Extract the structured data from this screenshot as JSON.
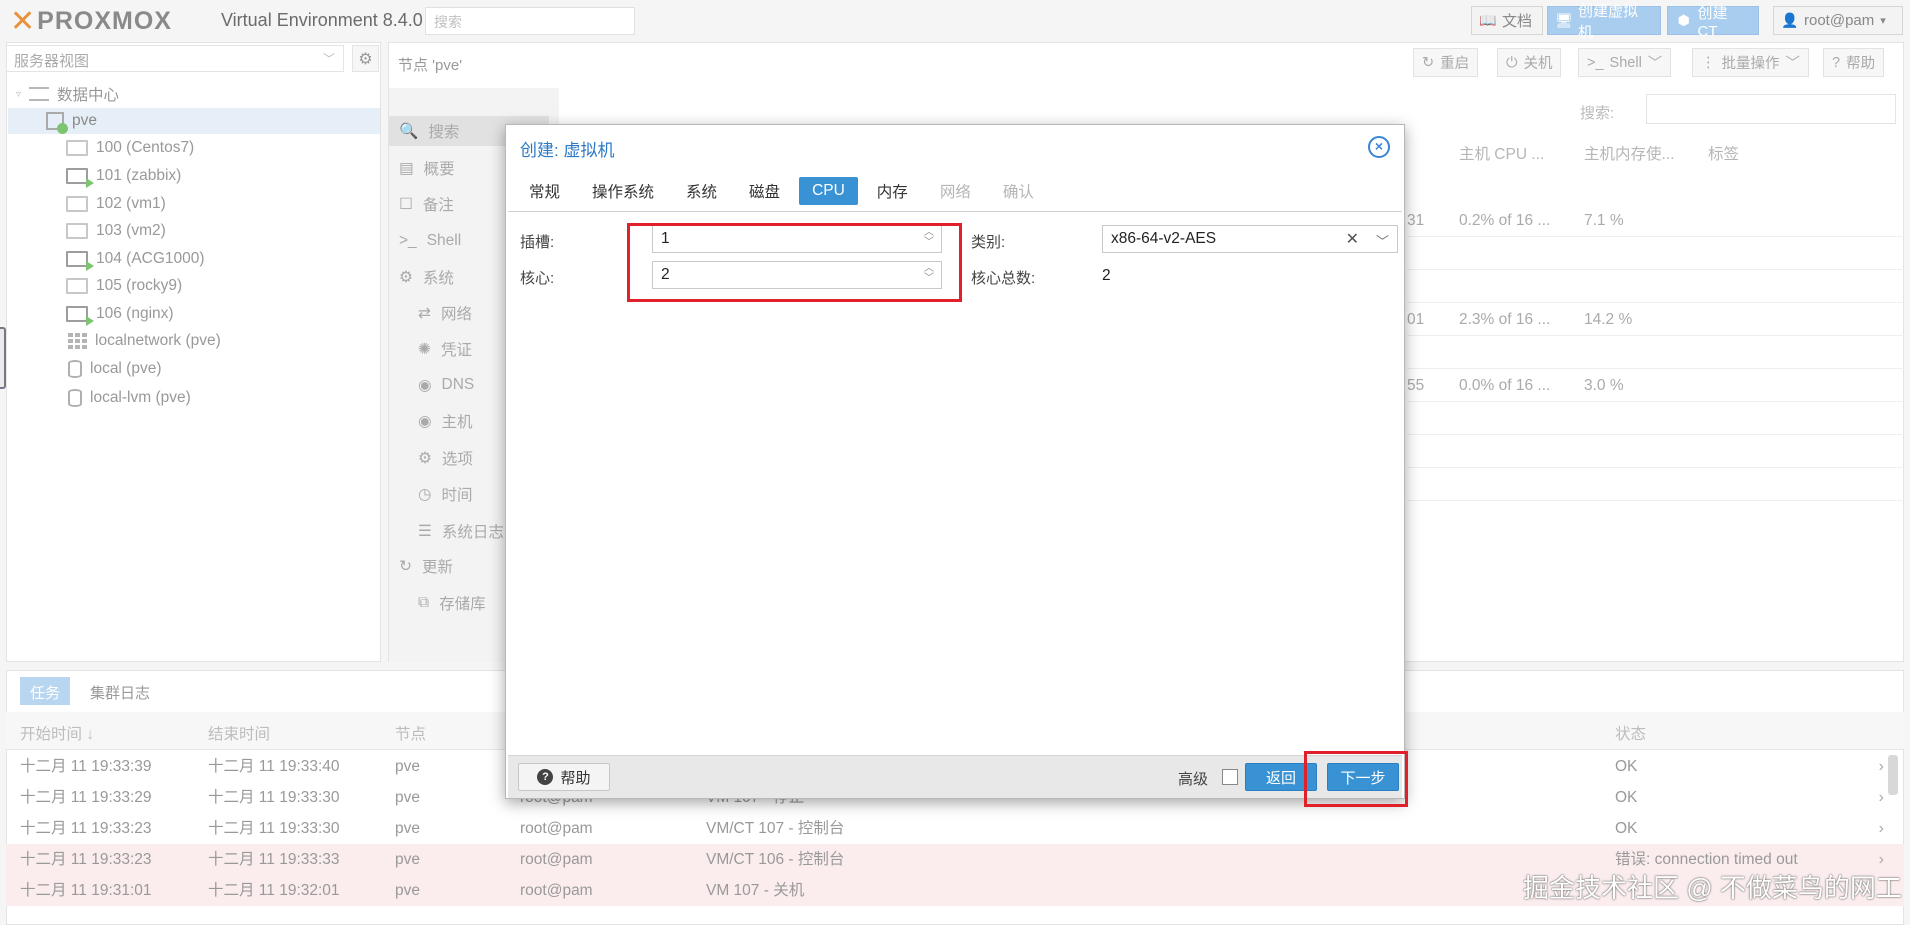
{
  "header": {
    "brand": "PROXMOX",
    "title": "Virtual Environment 8.4.0",
    "search_placeholder": "搜索",
    "docs_label": "文档",
    "create_vm_label": "创建虚拟机",
    "create_ct_label": "创建 CT",
    "user_label": "root@pam"
  },
  "tree": {
    "view_label": "服务器视图",
    "items": [
      {
        "label": "数据中心",
        "icon": "datacenter-icon"
      },
      {
        "label": "pve",
        "icon": "node-icon"
      },
      {
        "label": "100 (Centos7)",
        "icon": "vm-icon"
      },
      {
        "label": "101 (zabbix)",
        "icon": "vm-running-icon"
      },
      {
        "label": "102 (vm1)",
        "icon": "vm-icon"
      },
      {
        "label": "103 (vm2)",
        "icon": "vm-icon"
      },
      {
        "label": "104 (ACG1000)",
        "icon": "vm-running-icon"
      },
      {
        "label": "105 (rocky9)",
        "icon": "vm-icon"
      },
      {
        "label": "106 (nginx)",
        "icon": "vm-running-icon"
      },
      {
        "label": "localnetwork (pve)",
        "icon": "network-icon"
      },
      {
        "label": "local (pve)",
        "icon": "storage-icon"
      },
      {
        "label": "local-lvm (pve)",
        "icon": "storage-icon"
      }
    ]
  },
  "node": {
    "title": "节点 'pve'",
    "actions": [
      "重启",
      "关机",
      "Shell",
      "批量操作",
      "帮助"
    ],
    "nav": [
      "搜索",
      "概要",
      "备注",
      "Shell",
      "系统",
      "网络",
      "凭证",
      "DNS",
      "主机",
      "选项",
      "时间",
      "系统日志",
      "更新",
      "存储库"
    ],
    "search_label": "搜索:",
    "columns": [
      "主机 CPU ...",
      "主机内存使...",
      "标签"
    ],
    "rows": [
      {
        "prefix": "31",
        "cpu": "0.2% of 16 ...",
        "mem": "7.1 %"
      },
      {
        "prefix": "01",
        "cpu": "2.3% of 16 ...",
        "mem": "14.2 %"
      },
      {
        "prefix": "55",
        "cpu": "0.0% of 16 ...",
        "mem": "3.0 %"
      }
    ]
  },
  "dialog": {
    "title": "创建: 虚拟机",
    "tabs": [
      {
        "label": "常规",
        "state": "normal"
      },
      {
        "label": "操作系统",
        "state": "normal"
      },
      {
        "label": "系统",
        "state": "normal"
      },
      {
        "label": "磁盘",
        "state": "normal"
      },
      {
        "label": "CPU",
        "state": "active"
      },
      {
        "label": "内存",
        "state": "normal"
      },
      {
        "label": "网络",
        "state": "disabled"
      },
      {
        "label": "确认",
        "state": "disabled"
      }
    ],
    "sockets_label": "插槽:",
    "sockets_value": "1",
    "cores_label": "核心:",
    "cores_value": "2",
    "type_label": "类别:",
    "type_value": "x86-64-v2-AES",
    "total_cores_label": "核心总数:",
    "total_cores_value": "2",
    "help_label": "帮助",
    "advanced_label": "高级",
    "back_label": "返回",
    "next_label": "下一步"
  },
  "log": {
    "tabs": [
      "任务",
      "集群日志"
    ],
    "columns": [
      "开始时间 ↓",
      "结束时间",
      "节点",
      "状态"
    ],
    "rows": [
      {
        "start": "十二月 11 19:33:39",
        "end": "十二月 11 19:33:40",
        "node": "pve",
        "user": "",
        "desc": "",
        "status": "OK",
        "error": false
      },
      {
        "start": "十二月 11 19:33:29",
        "end": "十二月 11 19:33:30",
        "node": "pve",
        "user": "root@pam",
        "desc": "VM 107 - 停止",
        "status": "OK",
        "error": false
      },
      {
        "start": "十二月 11 19:33:23",
        "end": "十二月 11 19:33:30",
        "node": "pve",
        "user": "root@pam",
        "desc": "VM/CT 107 - 控制台",
        "status": "OK",
        "error": false
      },
      {
        "start": "十二月 11 19:33:23",
        "end": "十二月 11 19:33:33",
        "node": "pve",
        "user": "root@pam",
        "desc": "VM/CT 106 - 控制台",
        "status": "错误: connection timed out",
        "error": true
      },
      {
        "start": "十二月 11 19:31:01",
        "end": "十二月 11 19:32:01",
        "node": "pve",
        "user": "root@pam",
        "desc": "VM 107 - 关机",
        "status": "",
        "error": true
      }
    ]
  },
  "watermark": "掘金技术社区 @ 不做菜鸟的网工",
  "colors": {
    "accent": "#3892d4",
    "highlight": "#e0202a",
    "brand_orange": "#e57000"
  }
}
